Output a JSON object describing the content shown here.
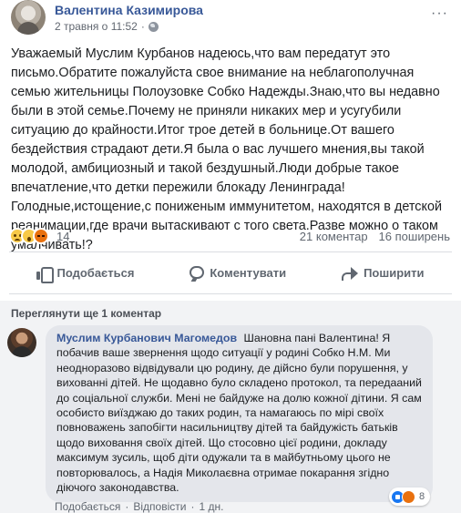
{
  "post": {
    "author": "Валентина Казимирова",
    "timestamp": "2 травня о 11:52",
    "separator": "·",
    "more_label": "···",
    "text": "Уважаемый Муслим Курбанов надеюсь,что вам передатут это письмо.Обратите пожалуйста свое внимание на неблагополучная семью жительницы Полоузовке Собко Надежды.Знаю,что вы недавно были в этой семье.Почему не приняли никаких мер и усугубили ситуацию до крайности.Итог трое детей в больнице.От вашего бездействия страдают дети.Я была о вас лучшего мнения,вы такой молодой, амбициозный и такой бездушный.Люди добрые такое впечатление,что детки пережили блокаду Ленинграда!Голодные,истощение,с пониженым иммунитетом, находятся в детской реанимации,где врачи вытаскивают с того света.Разве можно о таком умалчивать!?"
  },
  "reactions": {
    "count": "14",
    "comments": "21 коментар",
    "shares": "16 поширень",
    "icons": [
      "sad-icon",
      "wow-icon",
      "angry-icon"
    ]
  },
  "actions": {
    "like": "Подобається",
    "comment": "Коментувати",
    "share": "Поширити"
  },
  "comments": {
    "view_more": "Переглянути ще 1 коментар",
    "items": [
      {
        "author": "Муслим Курбанович Магомедов",
        "text": "Шановна пані Валентина! Я побачив ваше звернення щодо ситуації у родині Собко Н.М. Ми неодноразово відвідували цю родину, де дійсно були порушення, у вихованні дітей. Не щодавно було складено протокол, та передааний до соціальної служби. Мені не байдуже на долю кожної дітини. Я сам особисто виїзджаю до таких родин, та намагаюсь по мірі своїх повноважень запобігти насильництву дітей та байдужість батьків щодо виховання своїх дітей. Що стосовно цієї родини, докладу максимум зусиль, щоб діти одужали та в майбутньому цього не повторювалось, а Надія Миколаєвна отримае покарання згідно діючого законодавства.",
        "like_label": "Подобається",
        "reply_label": "Відповісти",
        "time": "1 дн.",
        "reaction_count": "8"
      }
    ]
  },
  "colors": {
    "link": "#385898",
    "muted": "#606770",
    "comment_bg": "#f2f3f5",
    "bubble_bg": "#e4e6eb"
  }
}
